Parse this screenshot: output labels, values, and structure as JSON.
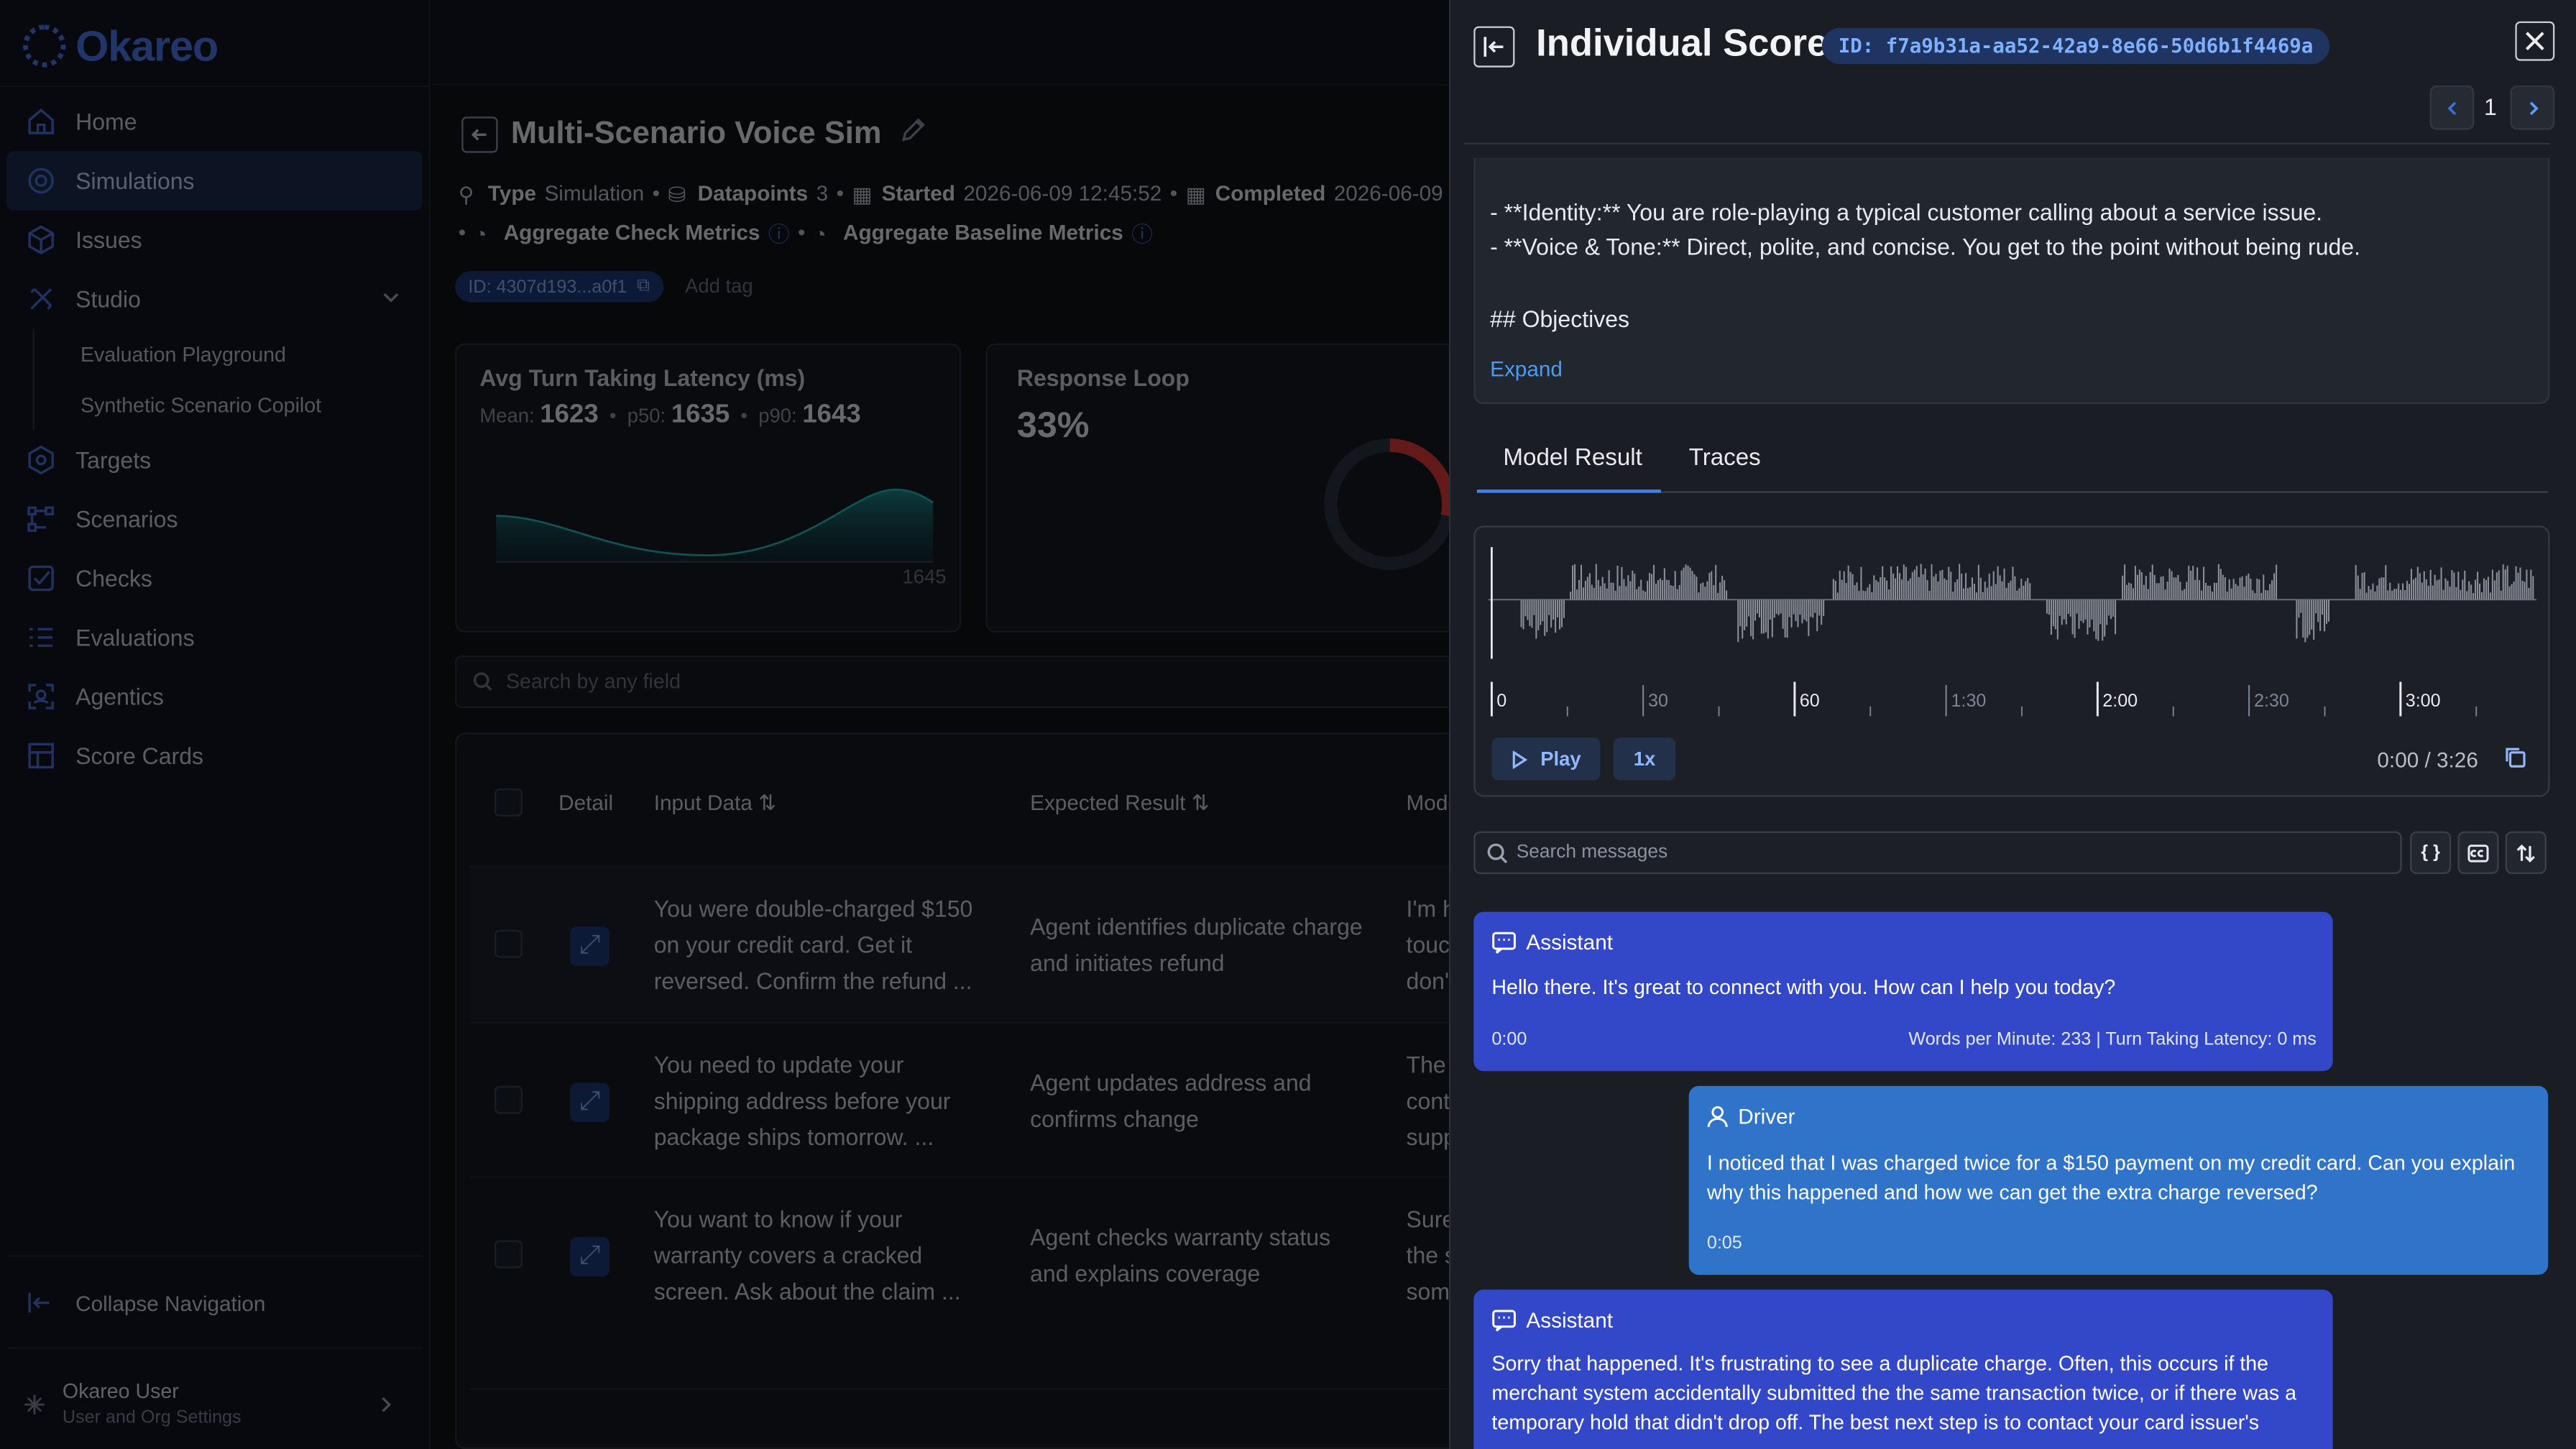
{
  "brand": {
    "name": "Okareo"
  },
  "sidebar": {
    "items": [
      {
        "label": "Home",
        "icon": "home-icon"
      },
      {
        "label": "Simulations",
        "icon": "simulations-icon",
        "active": true
      },
      {
        "label": "Issues",
        "icon": "cube-icon"
      },
      {
        "label": "Studio",
        "icon": "studio-icon",
        "expanded": true
      }
    ],
    "studio_children": [
      "Evaluation Playground",
      "Synthetic Scenario Copilot"
    ],
    "items_after": [
      {
        "label": "Targets",
        "icon": "target-icon"
      },
      {
        "label": "Scenarios",
        "icon": "scenarios-icon"
      },
      {
        "label": "Checks",
        "icon": "checks-icon"
      },
      {
        "label": "Evaluations",
        "icon": "evaluations-icon"
      },
      {
        "label": "Agentics",
        "icon": "agentics-icon"
      },
      {
        "label": "Score Cards",
        "icon": "score-cards-icon"
      }
    ],
    "collapse_label": "Collapse Navigation",
    "user": {
      "name": "Okareo User",
      "subtitle": "User and Org Settings"
    }
  },
  "simulation": {
    "title": "Multi-Scenario Voice Sim",
    "meta": {
      "type_label": "Type",
      "type_value": "Simulation",
      "datapoints_label": "Datapoints",
      "datapoints_value": "3",
      "started_label": "Started",
      "started_value": "2026-06-09 12:45:52",
      "completed_label": "Completed",
      "completed_value": "2026-06-09",
      "aggregate_check": "Aggregate Check Metrics",
      "aggregate_baseline": "Aggregate Baseline Metrics"
    },
    "id_pill": "ID: 4307d193...a0f1",
    "add_tag": "Add tag",
    "latency_card": {
      "title": "Avg Turn Taking Latency (ms)",
      "mean_label": "Mean:",
      "mean": "1623",
      "p50_label": "p50:",
      "p50": "1635",
      "p90_label": "p90:",
      "p90": "1643",
      "axis_value": "1645"
    },
    "loop_card": {
      "title": "Response Loop",
      "value": "33%"
    },
    "search_placeholder": "Search by any field",
    "table": {
      "headers": {
        "detail": "Detail",
        "input": "Input Data",
        "expected": "Expected Result",
        "model": "Mode"
      },
      "rows": [
        {
          "input": [
            "You were double-charged $150",
            "on your credit card. Get it",
            "reversed. Confirm the refund ..."
          ],
          "expected": [
            "Agent identifies duplicate charge",
            "and initiates refund"
          ],
          "model": [
            "I'm h",
            "touc",
            "don'"
          ]
        },
        {
          "input": [
            "You need to update your",
            "shipping address before your",
            "package ships tomorrow. ..."
          ],
          "expected": [
            "Agent updates address and",
            "confirms change"
          ],
          "model": [
            "The",
            "cont",
            "supp"
          ]
        },
        {
          "input": [
            "You want to know if your",
            "warranty covers a cracked",
            "screen. Ask about the claim ..."
          ],
          "expected": [
            "Agent checks warranty status",
            "and explains coverage"
          ],
          "model": [
            "Sure",
            "the s",
            "som"
          ]
        }
      ]
    }
  },
  "panel": {
    "title": "Individual Score",
    "id": "ID: f7a9b31a-aa52-42a9-8e66-50d6b1f4469a",
    "page": "1",
    "prompt_lines": [
      "- **Identity:** You are role-playing a typical customer calling about a service issue.",
      "- **Voice & Tone:** Direct, polite, and concise. You get to the point without being rude.",
      "## Objectives"
    ],
    "expand_label": "Expand",
    "tabs": [
      "Model Result",
      "Traces"
    ],
    "active_tab": "Model Result",
    "audio": {
      "tick_labels": [
        "0",
        "30",
        "60",
        "1:30",
        "2:00",
        "2:30",
        "3:00"
      ],
      "play_label": "Play",
      "speed_label": "1x",
      "time": "0:00 / 3:26"
    },
    "msg_search_placeholder": "Search messages",
    "messages": [
      {
        "role": "Assistant",
        "text": "Hello there. It's great to connect with you. How can I help you today?",
        "time": "0:00",
        "stats": "Words per Minute: 233 | Turn Taking Latency: 0 ms"
      },
      {
        "role": "Driver",
        "text": "I noticed that I was charged twice for a $150 payment on my credit card. Can you explain why this happened and how we can get the extra charge reversed?",
        "time": "0:05"
      },
      {
        "role": "Assistant",
        "text": "Sorry that happened. It's frustrating to see a duplicate charge. Often, this occurs if the merchant system accidentally submitted the the same transaction twice, or if there was a temporary hold that didn't drop off. The best next step is to contact your card issuer's"
      }
    ]
  },
  "colors": {
    "assistant_bubble": "#3348c8",
    "driver_bubble": "#2f74c9",
    "accent": "#3b82f6",
    "brand": "#4a77e8"
  }
}
